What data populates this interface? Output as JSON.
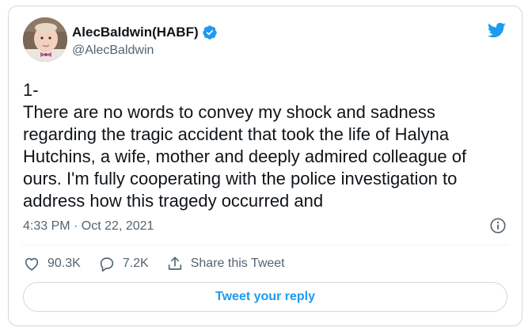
{
  "author": {
    "display_name": "AlecBaldwin(HABF)",
    "handle": "@AlecBaldwin",
    "verified": true
  },
  "tweet": {
    "text": "1-\nThere are no words to convey my shock and sadness regarding the tragic accident that took the life of Halyna Hutchins, a wife, mother and deeply admired colleague of ours. I'm fully cooperating with the police investigation to address how this tragedy occurred and",
    "timestamp": "4:33 PM · Oct 22, 2021"
  },
  "actions": {
    "likes": "90.3K",
    "replies": "7.2K",
    "share_label": "Share this Tweet"
  },
  "reply_button": {
    "label": "Tweet your reply"
  },
  "icons": {
    "brand": "twitter-bird-icon",
    "verified": "verified-badge-icon",
    "info": "info-icon",
    "like": "heart-icon",
    "reply": "speech-bubble-icon",
    "share": "share-upload-icon"
  },
  "colors": {
    "accent": "#1d9bf0",
    "text": "#0f1419",
    "secondary": "#536471",
    "border": "#cfd9de"
  }
}
